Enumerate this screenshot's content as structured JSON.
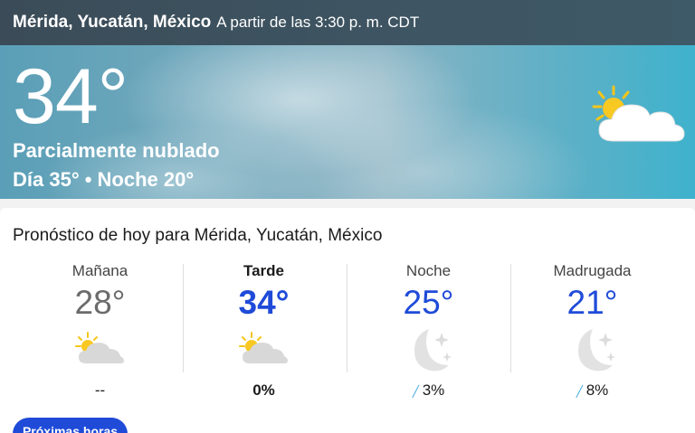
{
  "header": {
    "location": "Mérida, Yucatán, México",
    "as_of": "A partir de las 3:30 p. m. CDT"
  },
  "current": {
    "temperature": "34°",
    "condition": "Parcialmente nublado",
    "day_night": "Día 35° • Noche 20°",
    "icon": "partly-cloudy-icon"
  },
  "forecast": {
    "title": "Pronóstico de hoy para Mérida, Yucatán, México",
    "periods": [
      {
        "name": "Mañana",
        "temp": "28°",
        "icon": "partly-cloudy-icon",
        "precip": "--"
      },
      {
        "name": "Tarde",
        "temp": "34°",
        "icon": "partly-cloudy-icon",
        "precip": "0%"
      },
      {
        "name": "Noche",
        "temp": "25°",
        "icon": "moon-stars-icon",
        "precip": "3%"
      },
      {
        "name": "Madrugada",
        "temp": "21°",
        "icon": "moon-stars-icon",
        "precip": "8%"
      }
    ]
  },
  "next_hours_button": "Próximas horas",
  "colors": {
    "accent_blue": "#1f4bd8",
    "drop_blue": "#3aa6e0",
    "header_bg": "#3e5563",
    "sky": "#5fb0c6"
  }
}
